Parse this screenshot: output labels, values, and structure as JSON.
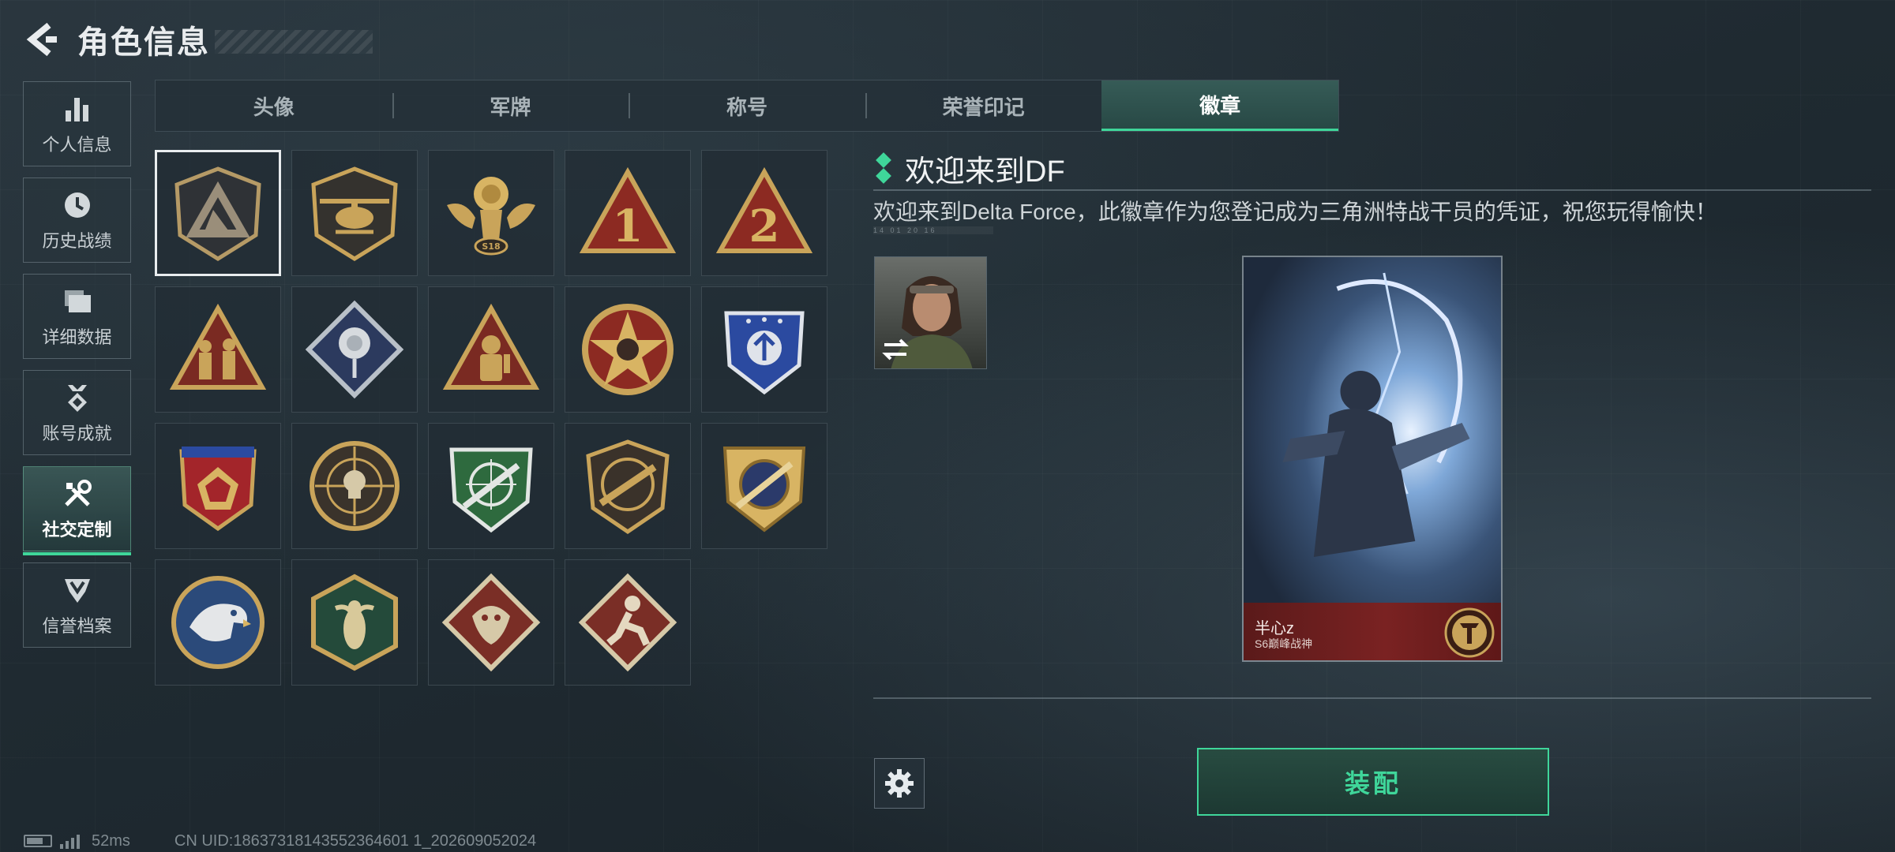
{
  "header": {
    "title": "角色信息"
  },
  "sidebar": {
    "items": [
      {
        "label": "个人信息",
        "icon": "bar-chart-icon",
        "active": false
      },
      {
        "label": "历史战绩",
        "icon": "clock-icon",
        "active": false
      },
      {
        "label": "详细数据",
        "icon": "folder-icon",
        "active": false
      },
      {
        "label": "账号成就",
        "icon": "achievement-icon",
        "active": false
      },
      {
        "label": "社交定制",
        "icon": "tools-icon",
        "active": true
      },
      {
        "label": "信誉档案",
        "icon": "reputation-icon",
        "active": false
      }
    ]
  },
  "tabs": [
    {
      "label": "头像",
      "active": false
    },
    {
      "label": "军牌",
      "active": false
    },
    {
      "label": "称号",
      "active": false
    },
    {
      "label": "荣誉印记",
      "active": false
    },
    {
      "label": "徽章",
      "active": true
    }
  ],
  "badges": [
    {
      "icon": "delta-shield-badge",
      "selected": true
    },
    {
      "icon": "helicopter-badge",
      "selected": false
    },
    {
      "icon": "s18-winged-badge",
      "selected": false
    },
    {
      "icon": "number-1-triangle-badge",
      "selected": false
    },
    {
      "icon": "number-2-triangle-badge",
      "selected": false
    },
    {
      "icon": "soldiers-triangle-badge",
      "selected": false
    },
    {
      "icon": "rose-diamond-badge",
      "selected": false
    },
    {
      "icon": "diver-triangle-badge",
      "selected": false
    },
    {
      "icon": "star-skull-badge",
      "selected": false
    },
    {
      "icon": "blue-wing-shield-badge",
      "selected": false
    },
    {
      "icon": "red-crest-badge",
      "selected": false
    },
    {
      "icon": "crosshair-skull-badge",
      "selected": false
    },
    {
      "icon": "green-rifle-shield-badge",
      "selected": false
    },
    {
      "icon": "rifle-round-badge",
      "selected": false
    },
    {
      "icon": "gold-rifle-shield-badge",
      "selected": false
    },
    {
      "icon": "eagle-round-badge",
      "selected": false
    },
    {
      "icon": "wasp-hex-badge",
      "selected": false
    },
    {
      "icon": "dragon-diamond-badge",
      "selected": false
    },
    {
      "icon": "runner-diamond-badge",
      "selected": false
    }
  ],
  "detail": {
    "title": "欢迎来到DF",
    "description": "欢迎来到Delta Force，此徽章作为您登记成为三角洲特战干员的凭证，祝您玩得愉快！",
    "subtext": "14 01    20 16"
  },
  "card": {
    "player_name": "半心z",
    "rank": "S6巅峰战神"
  },
  "equip_button": {
    "label": "装配"
  },
  "status": {
    "ping": "52ms",
    "uid": "CN UID:18637318143552364601 1_202609052024"
  },
  "colors": {
    "accent": "#3fd69a",
    "background": "#1f2a31",
    "card_footer": "#7a2222",
    "badge_gold": "#c9a45a"
  }
}
